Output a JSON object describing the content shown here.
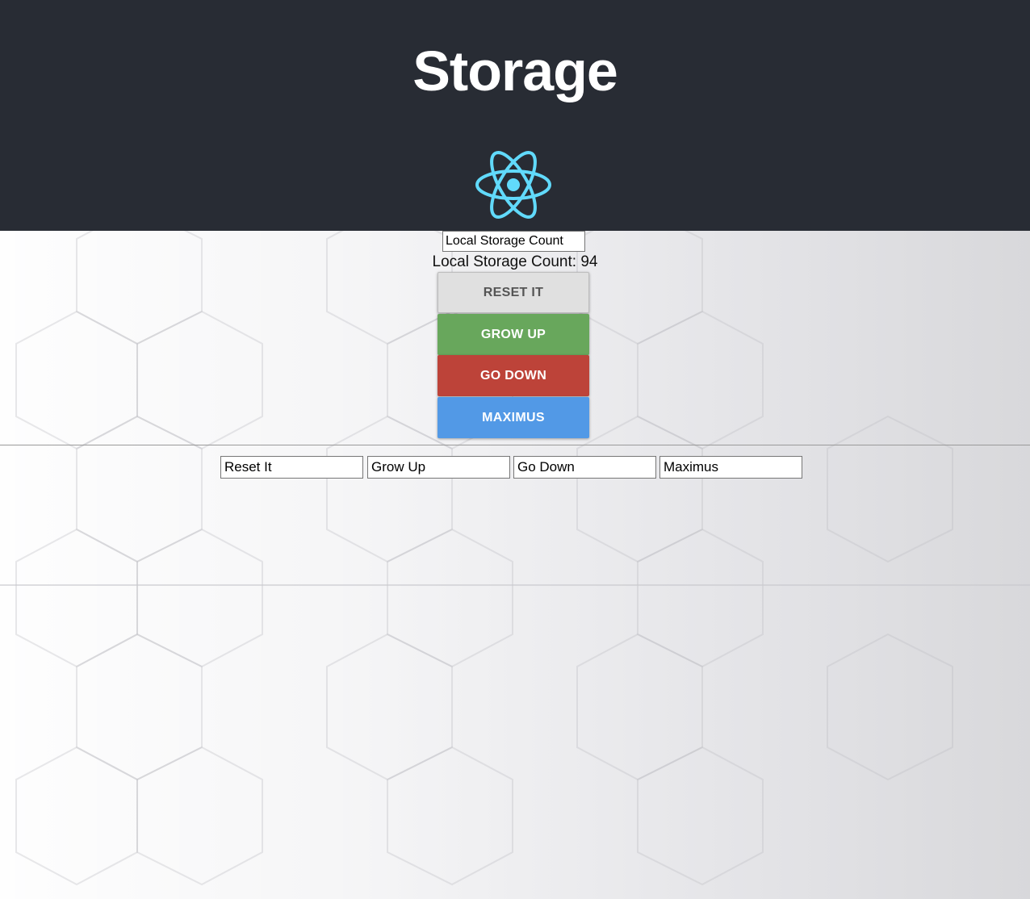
{
  "header": {
    "title": "Storage",
    "logo_icon": "react-atom-icon",
    "logo_color": "#61dafb",
    "background": "#282c34"
  },
  "counter": {
    "input_value": "Local Storage Count",
    "display_text": "Local Storage Count: 94"
  },
  "buttons": {
    "reset_label": "RESET IT",
    "grow_label": "GROW UP",
    "down_label": "GO DOWN",
    "max_label": "MAXIMUS",
    "colors": {
      "reset": "#e0e0e0",
      "grow": "#68a75c",
      "down": "#bd4339",
      "max": "#5299e6"
    }
  },
  "fields": {
    "reset_value": "Reset It",
    "grow_value": "Grow Up",
    "down_value": "Go Down",
    "max_value": "Maximus"
  }
}
